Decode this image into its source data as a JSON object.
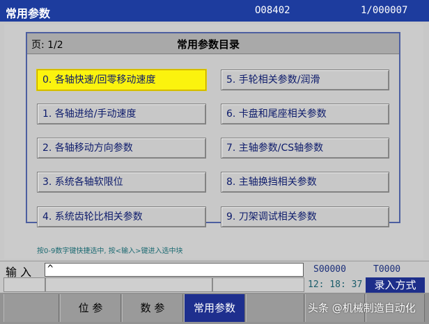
{
  "title_bar": {
    "title": "常用参数",
    "program": "O08402",
    "block": "1/000007"
  },
  "panel": {
    "page": "页: 1/2",
    "title": "常用参数目录",
    "options": [
      "0. 各轴快速/回零移动速度",
      "1. 各轴进给/手动速度",
      "2. 各轴移动方向参数",
      "3. 系统各轴软限位",
      "4. 系统齿轮比相关参数",
      "5. 手轮相关参数/润滑",
      "6. 卡盘和尾座相关参数",
      "7. 主轴参数/CS轴参数",
      "8. 主轴换挡相关参数",
      "9. 刀架调试相关参数"
    ],
    "selected_index": 0
  },
  "hint": "按0-9数字键快捷选中, 按<输入>键进入选中块",
  "input_row": {
    "label": "输 入",
    "value": "^",
    "s_value": "S00000",
    "t_value": "T0000"
  },
  "status_row": {
    "time": "12: 18: 37",
    "mode": "录入方式"
  },
  "softkeys": {
    "k1": "位 参",
    "k2": "数 参",
    "k3": "常用参数"
  },
  "watermark": "头条 @机械制造自动化",
  "colors": {
    "title_bg": "#1d3c9e",
    "selected": "#fbf30e",
    "active_key": "#1e2f8e"
  }
}
